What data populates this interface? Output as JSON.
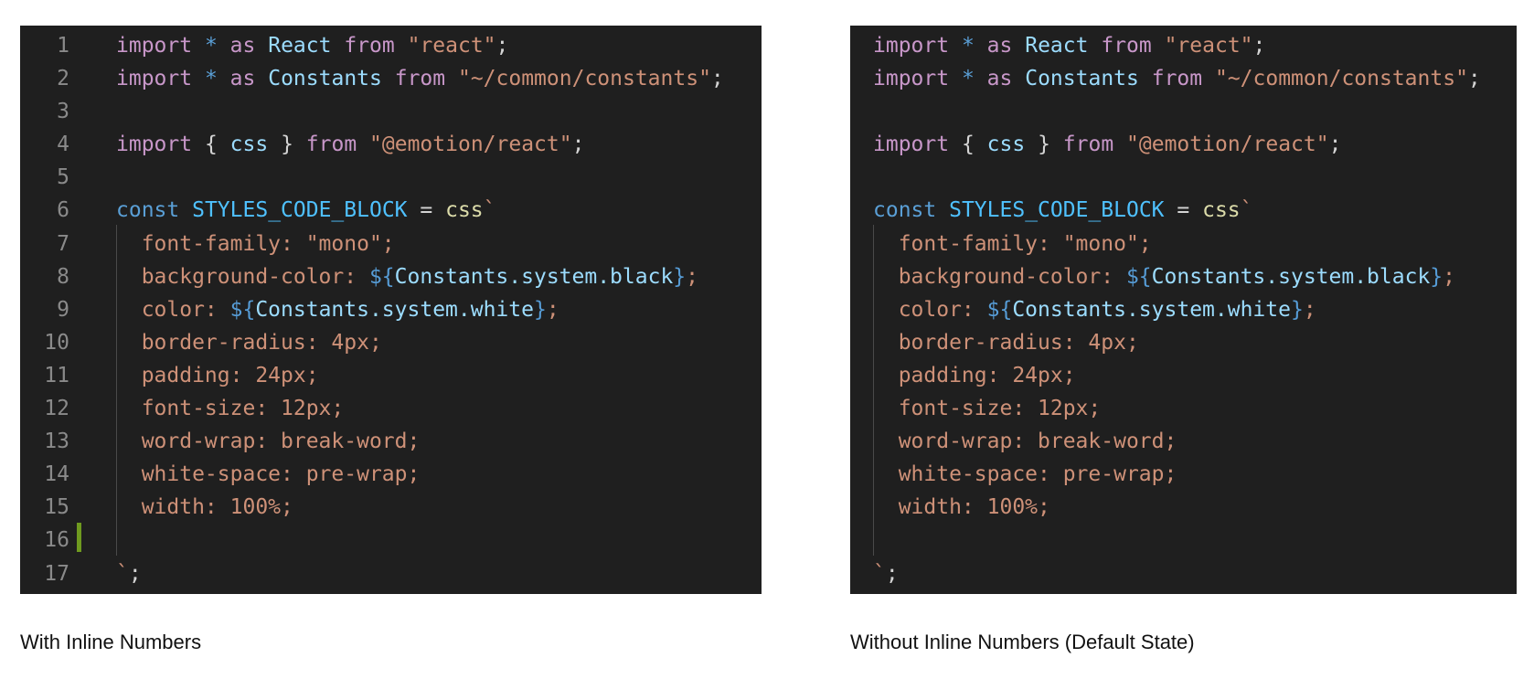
{
  "colors": {
    "background": "#1f1f1f",
    "keyword": "#c897c9",
    "declaration": "#5a9fd6",
    "identifier": "#9cdcfe",
    "constant": "#4fc1ff",
    "function": "#dcdcaa",
    "string": "#ce9178",
    "punctuation": "#d4d4d4",
    "line_number": "#8a8a8a",
    "modified_gutter": "#6f9a1f"
  },
  "panels": {
    "left": {
      "caption": "With Inline Numbers",
      "show_line_numbers": true
    },
    "right": {
      "caption": "Without Inline Numbers (Default State)",
      "show_line_numbers": false
    }
  },
  "code_lines": [
    {
      "n": "1",
      "tokens": [
        [
          "import",
          "keyword"
        ],
        [
          " ",
          "punct"
        ],
        [
          "*",
          "decl"
        ],
        [
          " ",
          "punct"
        ],
        [
          "as",
          "keyword"
        ],
        [
          " ",
          "punct"
        ],
        [
          "React",
          "var"
        ],
        [
          " ",
          "punct"
        ],
        [
          "from",
          "keyword"
        ],
        [
          " ",
          "punct"
        ],
        [
          "\"react\"",
          "str"
        ],
        [
          ";",
          "punct"
        ]
      ]
    },
    {
      "n": "2",
      "tokens": [
        [
          "import",
          "keyword"
        ],
        [
          " ",
          "punct"
        ],
        [
          "*",
          "decl"
        ],
        [
          " ",
          "punct"
        ],
        [
          "as",
          "keyword"
        ],
        [
          " ",
          "punct"
        ],
        [
          "Constants",
          "var"
        ],
        [
          " ",
          "punct"
        ],
        [
          "from",
          "keyword"
        ],
        [
          " ",
          "punct"
        ],
        [
          "\"~/common/constants\"",
          "str"
        ],
        [
          ";",
          "punct"
        ]
      ]
    },
    {
      "n": "3",
      "tokens": []
    },
    {
      "n": "4",
      "tokens": [
        [
          "import",
          "keyword"
        ],
        [
          " ",
          "punct"
        ],
        [
          "{",
          "punct"
        ],
        [
          " ",
          "punct"
        ],
        [
          "css",
          "var"
        ],
        [
          " ",
          "punct"
        ],
        [
          "}",
          "punct"
        ],
        [
          " ",
          "punct"
        ],
        [
          "from",
          "keyword"
        ],
        [
          " ",
          "punct"
        ],
        [
          "\"@emotion/react\"",
          "str"
        ],
        [
          ";",
          "punct"
        ]
      ]
    },
    {
      "n": "5",
      "tokens": []
    },
    {
      "n": "6",
      "tokens": [
        [
          "const",
          "decl"
        ],
        [
          " ",
          "punct"
        ],
        [
          "STYLES_CODE_BLOCK",
          "const"
        ],
        [
          " ",
          "punct"
        ],
        [
          "=",
          "punct"
        ],
        [
          " ",
          "punct"
        ],
        [
          "css",
          "fn"
        ],
        [
          "`",
          "str"
        ]
      ]
    },
    {
      "n": "7",
      "tokens": [
        [
          "  font-family: \"mono\";",
          "css"
        ]
      ]
    },
    {
      "n": "8",
      "tokens": [
        [
          "  background-color: ",
          "css"
        ],
        [
          "${",
          "interp"
        ],
        [
          "Constants.system.black",
          "var"
        ],
        [
          "}",
          "interp"
        ],
        [
          ";",
          "css"
        ]
      ]
    },
    {
      "n": "9",
      "tokens": [
        [
          "  color: ",
          "css"
        ],
        [
          "${",
          "interp"
        ],
        [
          "Constants.system.white",
          "var"
        ],
        [
          "}",
          "interp"
        ],
        [
          ";",
          "css"
        ]
      ]
    },
    {
      "n": "10",
      "tokens": [
        [
          "  border-radius: 4px;",
          "css"
        ]
      ]
    },
    {
      "n": "11",
      "tokens": [
        [
          "  padding: 24px;",
          "css"
        ]
      ]
    },
    {
      "n": "12",
      "tokens": [
        [
          "  font-size: 12px;",
          "css"
        ]
      ]
    },
    {
      "n": "13",
      "tokens": [
        [
          "  word-wrap: break-word;",
          "css"
        ]
      ]
    },
    {
      "n": "14",
      "tokens": [
        [
          "  white-space: pre-wrap;",
          "css"
        ]
      ]
    },
    {
      "n": "15",
      "tokens": [
        [
          "  width: 100%;",
          "css"
        ]
      ]
    },
    {
      "n": "16",
      "tokens": []
    },
    {
      "n": "17",
      "tokens": [
        [
          "`",
          "str"
        ],
        [
          ";",
          "punct"
        ]
      ]
    }
  ]
}
